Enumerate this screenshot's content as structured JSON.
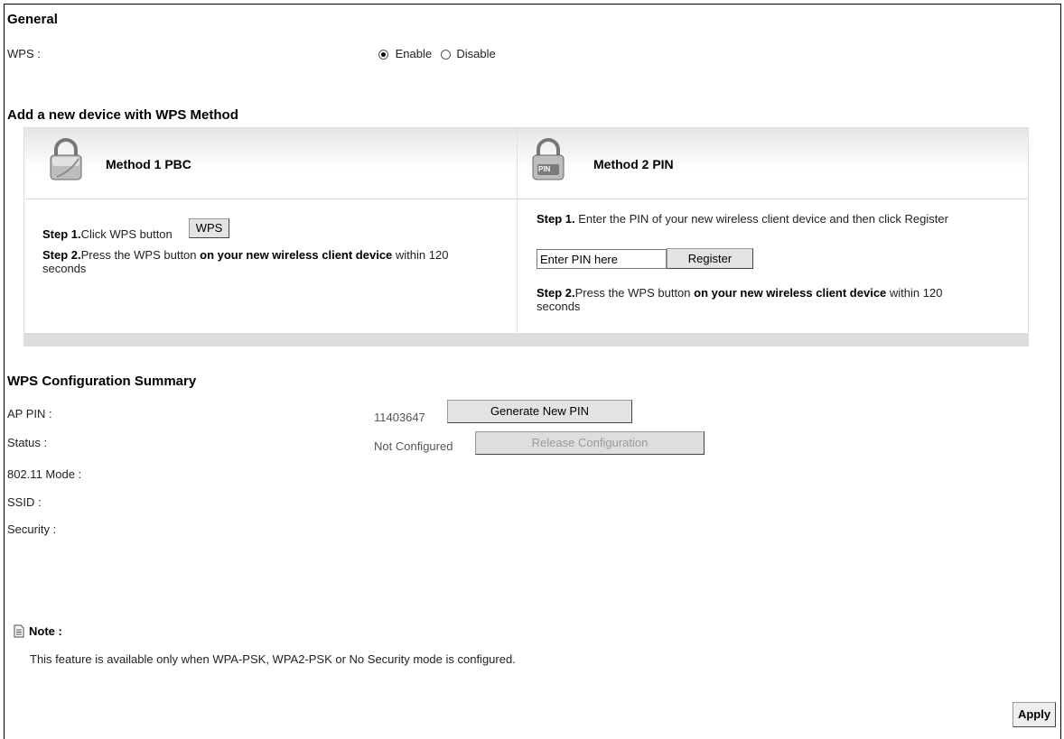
{
  "general": {
    "heading": "General",
    "wps_label": "WPS :",
    "enable_label": "Enable",
    "disable_label": "Disable",
    "wps_selected": "Enable"
  },
  "add_device": {
    "heading": "Add a new device with WPS Method",
    "method1": {
      "title": "Method 1 PBC",
      "step1_bold": "Step 1.",
      "step1_text": "Click WPS button",
      "wps_button": "WPS",
      "step2_bold": "Step 2.",
      "step2_text": "Press the WPS button ",
      "step2_bold2": "on your new wireless client device",
      "step2_tail": " within 120 seconds"
    },
    "method2": {
      "title": "Method 2 PIN",
      "icon_text": "PIN",
      "step1_bold": "Step 1.",
      "step1_text": " Enter the PIN of your new wireless client device and then click Register",
      "pin_input_value": "Enter PIN here",
      "register_button": "Register",
      "step2_bold": "Step 2.",
      "step2_text": "Press the WPS button ",
      "step2_bold2": "on your new wireless client device",
      "step2_tail": " within 120 seconds"
    }
  },
  "summary": {
    "heading": "WPS Configuration Summary",
    "ap_pin_label": "AP PIN :",
    "ap_pin_value": "11403647",
    "generate_button": "Generate New PIN",
    "status_label": "Status :",
    "status_value": "Not Configured",
    "release_button": "Release Configuration",
    "mode_label": "802.11 Mode :",
    "ssid_label": "SSID :",
    "security_label": "Security :"
  },
  "note": {
    "title": "Note :",
    "text": "This feature is available only when WPA-PSK, WPA2-PSK or No Security mode is configured."
  },
  "apply_button": "Apply"
}
